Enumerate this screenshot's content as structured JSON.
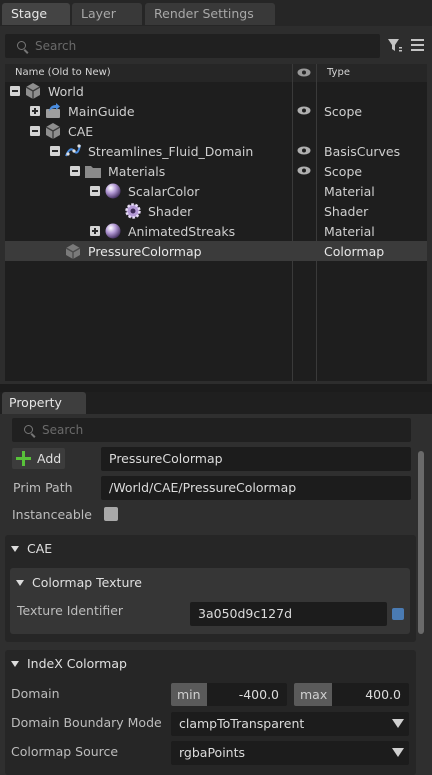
{
  "stage_tabs": [
    {
      "label": "Stage"
    },
    {
      "label": "Layer"
    },
    {
      "label": "Render Settings"
    }
  ],
  "stage": {
    "search_placeholder": "Search",
    "columns": {
      "name": "Name (Old to New)",
      "type": "Type"
    },
    "rows": [
      {
        "name": "World",
        "type": ""
      },
      {
        "name": "MainGuide",
        "type": "Scope"
      },
      {
        "name": "CAE",
        "type": ""
      },
      {
        "name": "Streamlines_Fluid_Domain",
        "type": "BasisCurves"
      },
      {
        "name": "Materials",
        "type": "Scope"
      },
      {
        "name": "ScalarColor",
        "type": "Material"
      },
      {
        "name": "Shader",
        "type": "Shader"
      },
      {
        "name": "AnimatedStreaks",
        "type": "Material"
      },
      {
        "name": "PressureColormap",
        "type": "Colormap"
      }
    ]
  },
  "property": {
    "tab_label": "Property",
    "search_placeholder": "Search",
    "add_label": "Add",
    "prim_name": "PressureColormap",
    "prim_path_label": "Prim Path",
    "prim_path": "/World/CAE/PressureColormap",
    "instanceable_label": "Instanceable",
    "cae_section": "CAE",
    "colormap_texture_section": "Colormap Texture",
    "texture_identifier_label": "Texture Identifier",
    "texture_identifier": "3a050d9c127d",
    "index_section": "IndeX Colormap",
    "domain_label": "Domain",
    "min_label": "min",
    "min_value": "-400.0",
    "max_label": "max",
    "max_value": "400.0",
    "boundary_label": "Domain Boundary Mode",
    "boundary_value": "clampToTransparent",
    "source_label": "Colormap Source",
    "source_value": "rgbaPoints"
  },
  "colors": {
    "accent_green": "#58c23a",
    "swatch_blue": "#4a7bb3",
    "selected_row": "#3b3b3b"
  }
}
